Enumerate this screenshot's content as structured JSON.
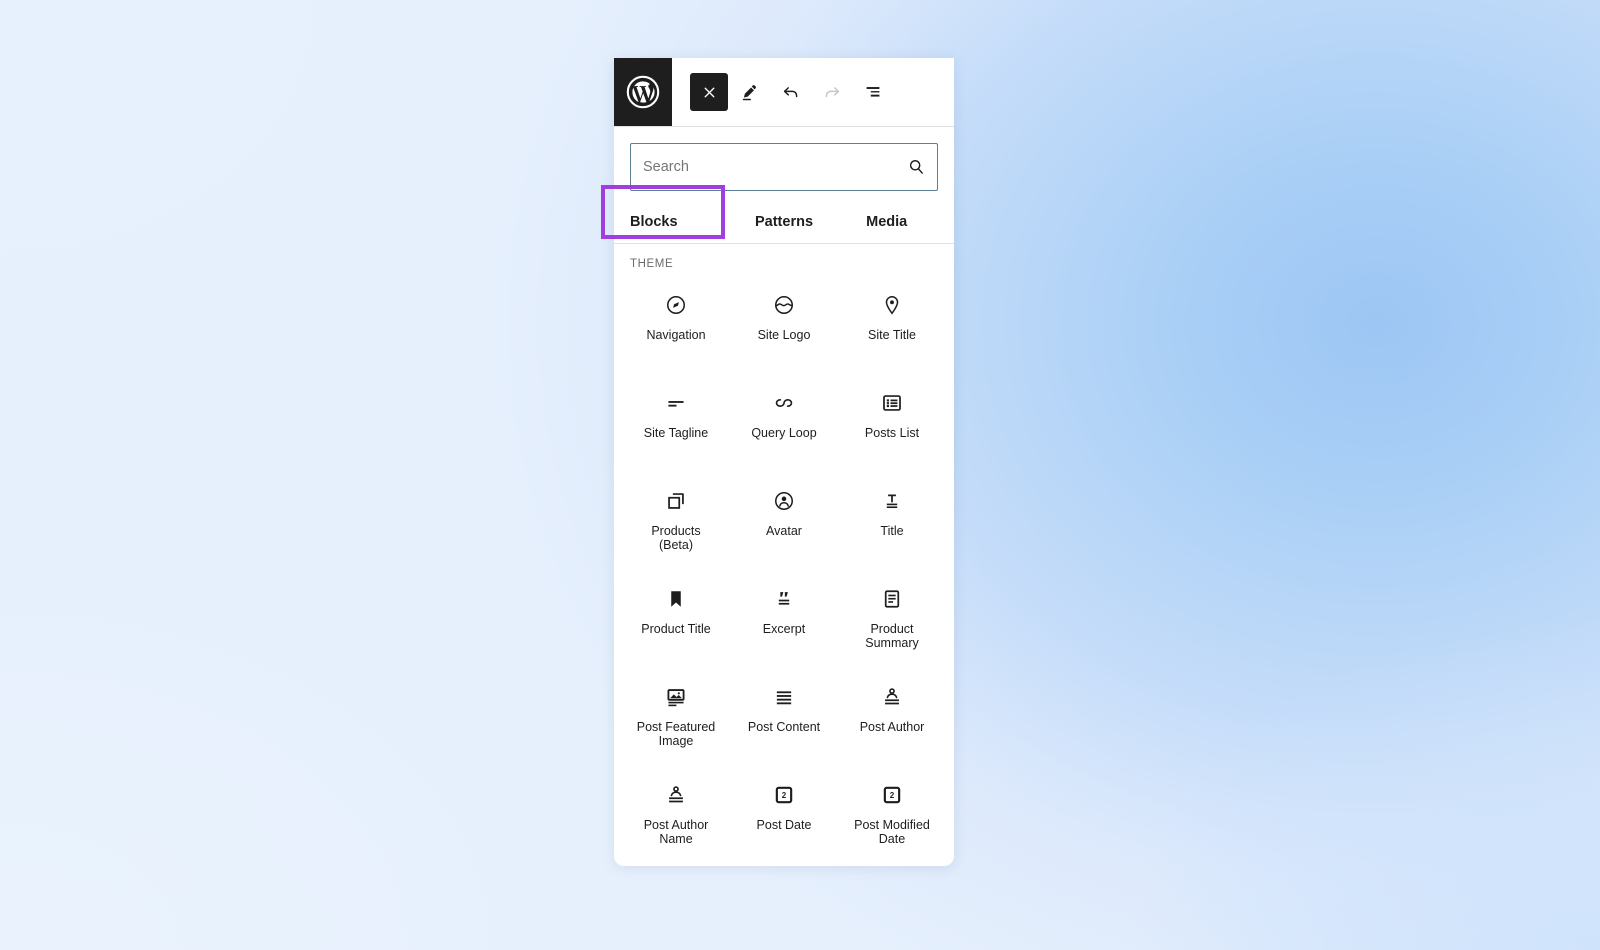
{
  "header": {
    "logo_icon": "wordpress-logo-icon",
    "tools": [
      {
        "name": "close-inserter-button",
        "icon": "close-x-icon",
        "label": "Close block inserter",
        "style": "dark",
        "disabled": false
      },
      {
        "name": "edit-tool-button",
        "icon": "pencil-edit-icon",
        "label": "Edit",
        "style": "plain",
        "disabled": false
      },
      {
        "name": "undo-button",
        "icon": "undo-arrow-icon",
        "label": "Undo",
        "style": "plain",
        "disabled": false
      },
      {
        "name": "redo-button",
        "icon": "redo-arrow-icon",
        "label": "Redo",
        "style": "plain",
        "disabled": true
      },
      {
        "name": "list-view-button",
        "icon": "list-view-icon",
        "label": "Document Overview",
        "style": "plain",
        "disabled": false
      }
    ]
  },
  "search": {
    "placeholder": "Search",
    "value": "",
    "icon": "search-magnifier-icon",
    "border_color": "#5b7f93"
  },
  "tabs": [
    {
      "label": "Blocks",
      "name": "tab-blocks",
      "selected": true
    },
    {
      "label": "Patterns",
      "name": "tab-patterns",
      "selected": false
    },
    {
      "label": "Media",
      "name": "tab-media",
      "selected": false
    }
  ],
  "highlight": {
    "target": "tab-blocks",
    "color": "#a03ee0"
  },
  "block_category": "THEME",
  "blocks": [
    {
      "label": "Navigation",
      "icon": "compass-icon"
    },
    {
      "label": "Site Logo",
      "icon": "site-logo-icon"
    },
    {
      "label": "Site Title",
      "icon": "map-pin-icon"
    },
    {
      "label": "Site Tagline",
      "icon": "tagline-lines-icon"
    },
    {
      "label": "Query Loop",
      "icon": "loop-icon"
    },
    {
      "label": "Posts List",
      "icon": "posts-list-icon"
    },
    {
      "label": "Products\n(Beta)",
      "icon": "copy-squares-icon"
    },
    {
      "label": "Avatar",
      "icon": "avatar-icon"
    },
    {
      "label": "Title",
      "icon": "title-t-icon"
    },
    {
      "label": "Product Title",
      "icon": "bookmark-icon"
    },
    {
      "label": "Excerpt",
      "icon": "quote-excerpt-icon"
    },
    {
      "label": "Product\nSummary",
      "icon": "document-icon"
    },
    {
      "label": "Post Featured\nImage",
      "icon": "featured-image-icon"
    },
    {
      "label": "Post Content",
      "icon": "content-lines-icon"
    },
    {
      "label": "Post Author",
      "icon": "post-author-icon"
    },
    {
      "label": "Post Author\nName",
      "icon": "post-author-name-icon"
    },
    {
      "label": "Post Date",
      "icon": "calendar-icon"
    },
    {
      "label": "Post Modified\nDate",
      "icon": "calendar-icon"
    }
  ]
}
